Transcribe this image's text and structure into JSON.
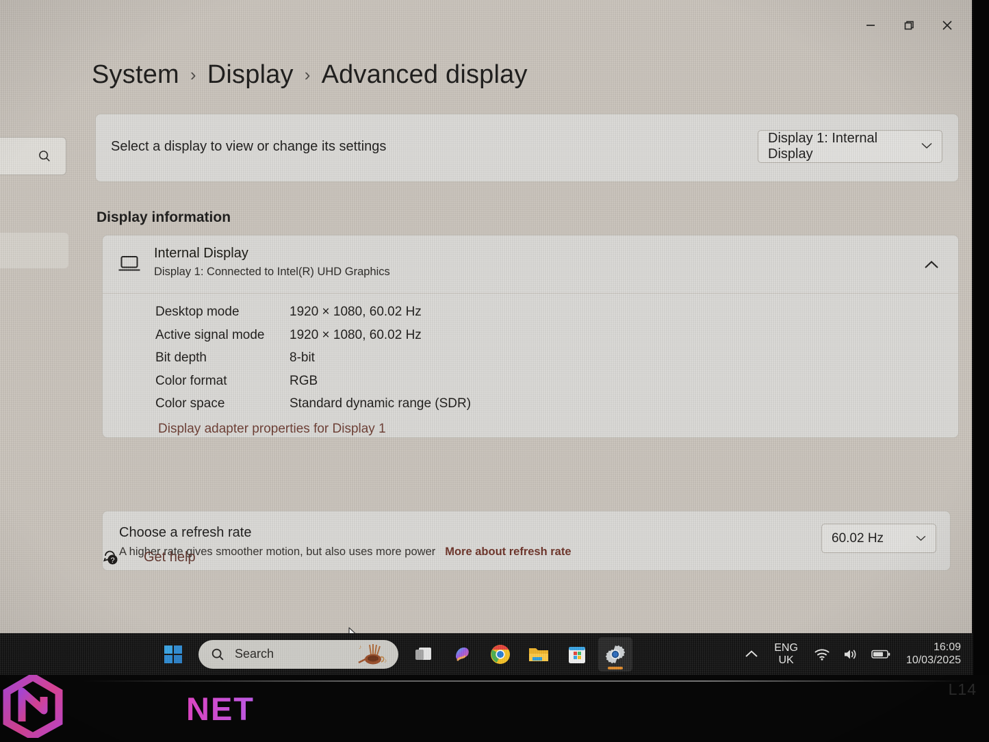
{
  "window": {
    "controls": [
      {
        "name": "minimize",
        "label": "Minimize"
      },
      {
        "name": "restore",
        "label": "Restore"
      },
      {
        "name": "close",
        "label": "Close"
      }
    ]
  },
  "sidebar": {
    "search_placeholder": "Search"
  },
  "breadcrumb": {
    "items": [
      {
        "label": "System"
      },
      {
        "label": "Display"
      },
      {
        "label": "Advanced display"
      }
    ],
    "separator": "›"
  },
  "select_display": {
    "label": "Select a display to view or change its settings",
    "selected": "Display 1: Internal Display",
    "chevron": "⌄"
  },
  "display_information": {
    "heading": "Display information",
    "display_name": "Internal Display",
    "display_subtitle": "Display 1: Connected to Intel(R) UHD Graphics",
    "rows": [
      {
        "label": "Desktop mode",
        "value": "1920 × 1080, 60.02 Hz"
      },
      {
        "label": "Active signal mode",
        "value": "1920 × 1080, 60.02 Hz"
      },
      {
        "label": "Bit depth",
        "value": "8-bit"
      },
      {
        "label": "Color format",
        "value": "RGB"
      },
      {
        "label": "Color space",
        "value": "Standard dynamic range (SDR)"
      }
    ],
    "adapter_link": "Display adapter properties for Display 1"
  },
  "refresh_rate": {
    "title": "Choose a refresh rate",
    "description": "A higher rate gives smoother motion, but also uses more power",
    "link": "More about refresh rate",
    "selected": "60.02 Hz"
  },
  "get_help": {
    "label": "Get help"
  },
  "taskbar": {
    "search_placeholder": "Search",
    "items": [
      {
        "name": "start",
        "label": "Start"
      },
      {
        "name": "task-view",
        "label": "Task View"
      },
      {
        "name": "copilot",
        "label": "Copilot"
      },
      {
        "name": "chrome",
        "label": "Google Chrome"
      },
      {
        "name": "file-explorer",
        "label": "File Explorer"
      },
      {
        "name": "microsoft-store",
        "label": "Microsoft Store"
      },
      {
        "name": "settings",
        "label": "Settings"
      }
    ],
    "tray": {
      "language_line1": "ENG",
      "language_line2": "UK",
      "time": "16:09",
      "date": "10/03/2025"
    }
  },
  "overlay": {
    "watermark_text": "NET",
    "model_label": "L14"
  },
  "colors": {
    "page_bg": "#cbc5bd",
    "card_bg": "#dcdbd8",
    "link": "#6d3d33",
    "taskbar_bg": "#141414",
    "active_indicator": "#e08b2a",
    "watermark": "#d65fd8"
  }
}
